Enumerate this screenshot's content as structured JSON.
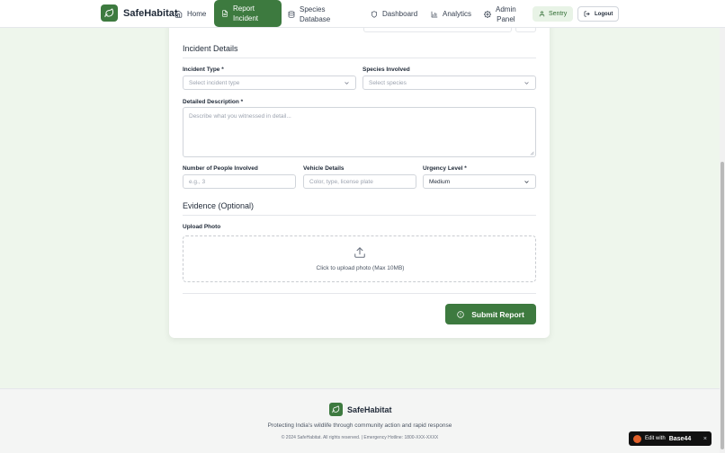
{
  "brand": {
    "name": "SafeHabitat"
  },
  "nav": {
    "home": "Home",
    "report_line1": "Report",
    "report_line2": "Incident",
    "species_line1": "Species",
    "species_line2": "Database",
    "dashboard": "Dashboard",
    "analytics": "Analytics",
    "admin_line1": "Admin",
    "admin_line2": "Panel",
    "user": "Sentry",
    "logout": "Logout"
  },
  "form": {
    "incident_section": "Incident Details",
    "incident_type_label": "Incident Type *",
    "incident_type_placeholder": "Select incident type",
    "species_label": "Species Involved",
    "species_placeholder": "Select species",
    "description_label": "Detailed Description *",
    "description_placeholder": "Describe what you witnessed in detail...",
    "people_label": "Number of People Involved",
    "people_placeholder": "e.g., 3",
    "vehicle_label": "Vehicle Details",
    "vehicle_placeholder": "Color, type, license plate",
    "urgency_label": "Urgency Level *",
    "urgency_value": "Medium",
    "evidence_section": "Evidence (Optional)",
    "upload_label": "Upload Photo",
    "upload_text": "Click to upload photo (Max 10MB)",
    "submit": "Submit Report"
  },
  "footer": {
    "name": "SafeHabitat",
    "tagline": "Protecting India's wildlife through community action and rapid response",
    "copyright": "© 2024 SafeHabitat. All rights reserved. | Emergency Hotline: 1800-XXX-XXXX"
  },
  "badge": {
    "prefix": "Edit with",
    "brand": "Base44",
    "close": "×"
  },
  "colors": {
    "accent": "#3d7a3f",
    "page_bg": "#eef6ec"
  }
}
